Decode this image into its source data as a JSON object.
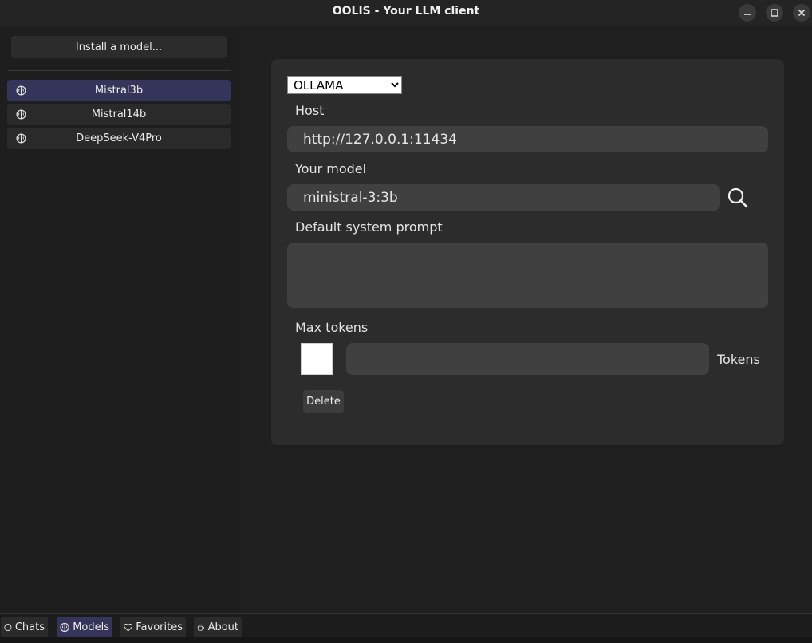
{
  "window": {
    "title": "OOLIS - Your LLM client"
  },
  "sidebar": {
    "install_label": "Install a model...",
    "models": [
      {
        "label": "Mistral3b",
        "active": true
      },
      {
        "label": "Mistral14b",
        "active": false
      },
      {
        "label": "DeepSeek-V4Pro",
        "active": false
      }
    ]
  },
  "form": {
    "provider": "OLLAMA",
    "host_label": "Host",
    "host_value": "http://127.0.0.1:11434",
    "model_label": "Your model",
    "model_value": "ministral-3:3b",
    "system_prompt_label": "Default system prompt",
    "system_prompt_value": "",
    "max_tokens_label": "Max tokens",
    "max_tokens_value": "",
    "tokens_unit": "Tokens",
    "delete_label": "Delete"
  },
  "tabs": [
    {
      "label": "Chats",
      "icon": "circle-icon"
    },
    {
      "label": "Models",
      "icon": "brain-icon",
      "active": true
    },
    {
      "label": "Favorites",
      "icon": "heart-icon"
    },
    {
      "label": "About",
      "icon": "coffee-icon"
    }
  ]
}
